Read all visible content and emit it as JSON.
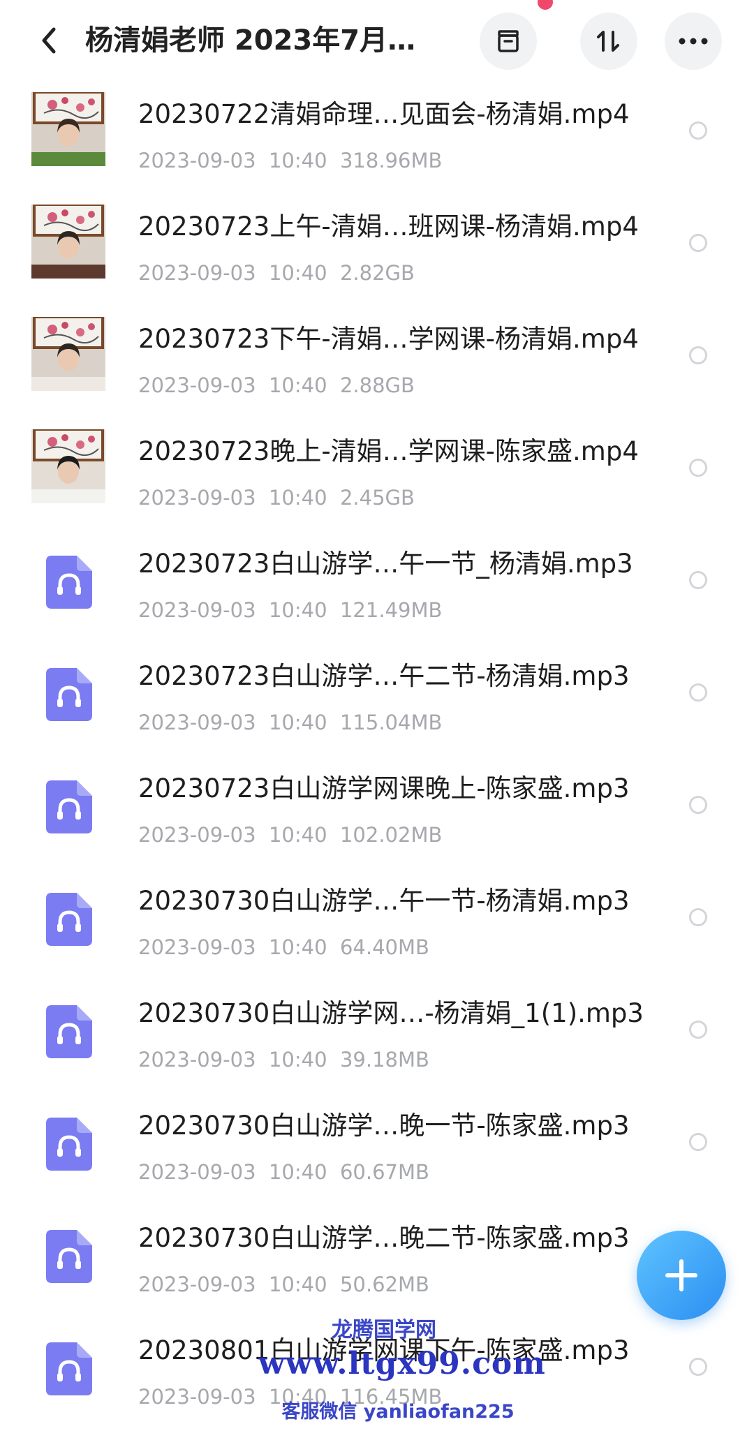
{
  "header": {
    "title": "杨清娟老师 2023年7月…",
    "back_icon": "chevron-left-icon",
    "actions": [
      "archive-icon",
      "sort-icon",
      "more-icon"
    ]
  },
  "files": [
    {
      "name": "20230722清娟命理…见面会-杨清娟.mp4",
      "date": "2023-09-03  10:40",
      "size": "318.96MB",
      "kind": "video"
    },
    {
      "name": "20230723上午-清娟…班网课-杨清娟.mp4",
      "date": "2023-09-03  10:40",
      "size": "2.82GB",
      "kind": "video"
    },
    {
      "name": "20230723下午-清娟…学网课-杨清娟.mp4",
      "date": "2023-09-03  10:40",
      "size": "2.88GB",
      "kind": "video"
    },
    {
      "name": "20230723晚上-清娟…学网课-陈家盛.mp4",
      "date": "2023-09-03  10:40",
      "size": "2.45GB",
      "kind": "video"
    },
    {
      "name": "20230723白山游学…午一节_杨清娟.mp3",
      "date": "2023-09-03  10:40",
      "size": "121.49MB",
      "kind": "audio"
    },
    {
      "name": "20230723白山游学…午二节-杨清娟.mp3",
      "date": "2023-09-03  10:40",
      "size": "115.04MB",
      "kind": "audio"
    },
    {
      "name": "20230723白山游学网课晚上-陈家盛.mp3",
      "date": "2023-09-03  10:40",
      "size": "102.02MB",
      "kind": "audio"
    },
    {
      "name": "20230730白山游学…午一节-杨清娟.mp3",
      "date": "2023-09-03  10:40",
      "size": "64.40MB",
      "kind": "audio"
    },
    {
      "name": "20230730白山游学网…-杨清娟_1(1).mp3",
      "date": "2023-09-03  10:40",
      "size": "39.18MB",
      "kind": "audio"
    },
    {
      "name": "20230730白山游学…晚一节-陈家盛.mp3",
      "date": "2023-09-03  10:40",
      "size": "60.67MB",
      "kind": "audio"
    },
    {
      "name": "20230730白山游学…晚二节-陈家盛.mp3",
      "date": "2023-09-03  10:40",
      "size": "50.62MB",
      "kind": "audio"
    },
    {
      "name": "20230801白山游学网课下午-陈家盛.mp3",
      "date": "2023-09-03  10:40",
      "size": "116.45MB",
      "kind": "audio"
    }
  ],
  "fab": {
    "icon": "plus-icon"
  },
  "watermark": {
    "line1": "龙腾国学网",
    "line2": "www.ltgx99.com",
    "line3": "客服微信 yanliaofan225"
  },
  "colors": {
    "accent": "#2b8ff2",
    "audio_icon": "#7b7cf2",
    "meta_text": "#a6a8ad"
  }
}
